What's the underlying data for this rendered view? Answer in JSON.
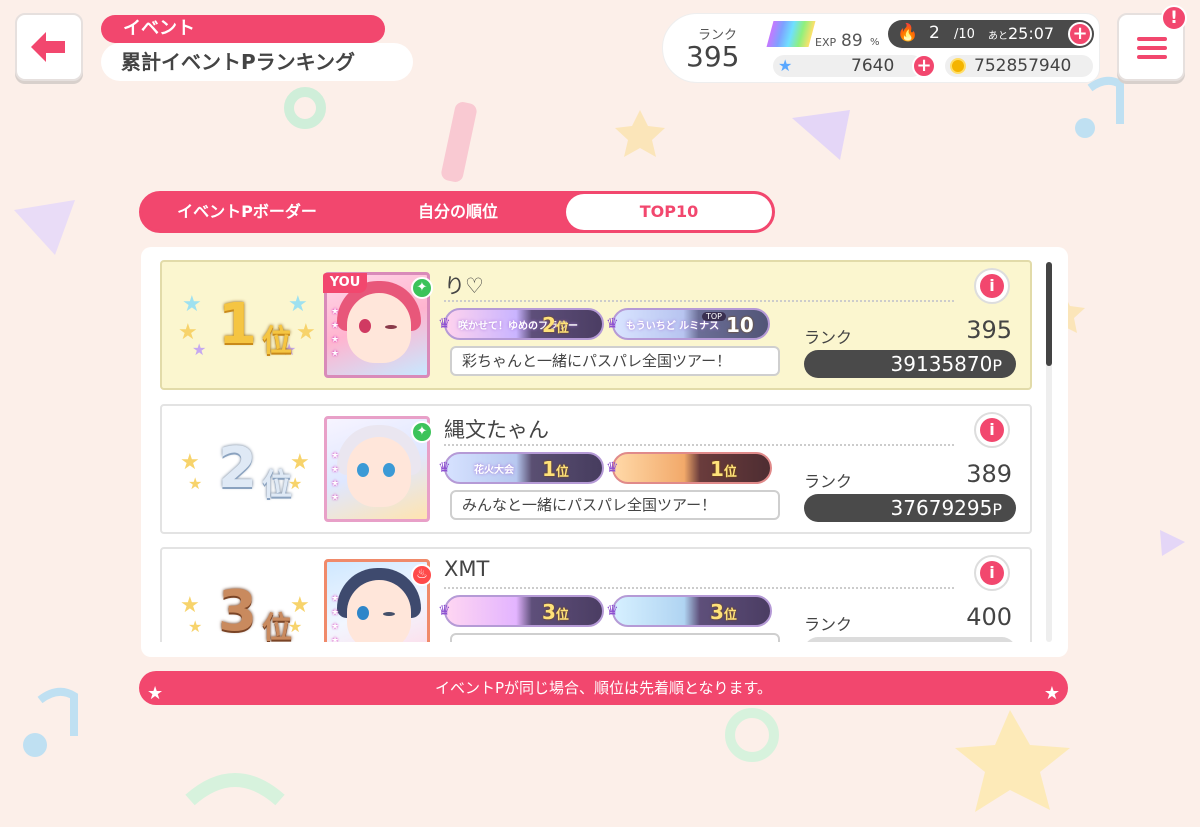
{
  "header": {
    "category": "イベント",
    "title": "累計イベントPランキング"
  },
  "status": {
    "rank_label": "ランク",
    "rank_value": "395",
    "exp_label": "EXP",
    "exp_value": "89",
    "exp_unit": "%",
    "stamina_current": "2",
    "stamina_max": "/10",
    "stamina_prefix": "あと",
    "stamina_timer": "25:07",
    "gems": "7640",
    "coins": "752857940",
    "alert": "!"
  },
  "tabs": [
    {
      "label": "イベントPボーダー",
      "active": false
    },
    {
      "label": "自分の順位",
      "active": false
    },
    {
      "label": "TOP10",
      "active": true
    }
  ],
  "rows": [
    {
      "rank_num": "1",
      "rank_suffix": "位",
      "you_tag": "YOU",
      "name": "り♡",
      "attribute": "pure",
      "titles": [
        {
          "event": "咲かせて！ゆめのフラワー",
          "rank": "2",
          "suffix": "位"
        },
        {
          "event": "もういちど ルミナス",
          "top_label": "TOP",
          "rank": "10",
          "suffix": ""
        }
      ],
      "comment": "彩ちゃんと一緒にパスパレ全国ツアー！",
      "rank_label": "ランク",
      "player_rank": "395",
      "points": "39135870",
      "points_unit": "P"
    },
    {
      "rank_num": "2",
      "rank_suffix": "位",
      "you_tag": "",
      "name": "縄文たゃん",
      "attribute": "pure",
      "titles": [
        {
          "event": "花火大会",
          "rank": "1",
          "suffix": "位"
        },
        {
          "event": "",
          "rank": "1",
          "suffix": "位"
        }
      ],
      "comment": "みんなと一緒にパスパレ全国ツアー！",
      "rank_label": "ランク",
      "player_rank": "389",
      "points": "37679295",
      "points_unit": "P"
    },
    {
      "rank_num": "3",
      "rank_suffix": "位",
      "you_tag": "",
      "name": "XMT",
      "attribute": "powerful",
      "titles": [
        {
          "event": "",
          "rank": "3",
          "suffix": "位"
        },
        {
          "event": "",
          "rank": "3",
          "suffix": "位"
        }
      ],
      "comment": "",
      "rank_label": "ランク",
      "player_rank": "400",
      "points": "",
      "points_unit": ""
    }
  ],
  "notice": "イベントPが同じ場合、順位は先着順となります。",
  "colors": {
    "accent": "#f2476e",
    "background": "#fcefe9",
    "highlight_row": "#fbf6cf",
    "gold": "#f5c542",
    "silver": "#c6d7ea",
    "bronze": "#c98a5e"
  }
}
